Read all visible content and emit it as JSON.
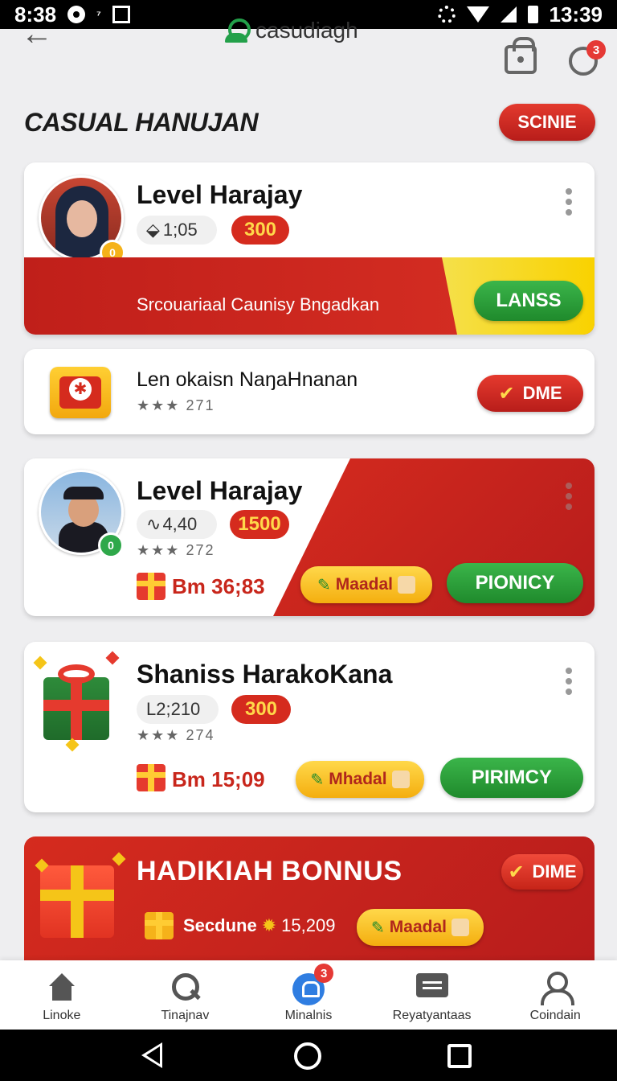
{
  "status_bar": {
    "time_left": "8:38",
    "time_right": "13:39",
    "small_glyph": "⁷"
  },
  "header": {
    "brand": "casudiagh",
    "notif_count": "3"
  },
  "page": {
    "title": "CASUAL HANUJAN",
    "action": "SCINIE"
  },
  "cards": [
    {
      "title": "Level Harajay",
      "stat": "1;05",
      "points": "300",
      "banner_text": "Srcouariaal Caunisy Bngadkan",
      "button": "LANSS",
      "avatar_badge": "0"
    },
    {
      "title": "Len okaisn NaŋaHnanan",
      "rating": "271",
      "button": "DME"
    },
    {
      "title": "Level Harajay",
      "stat": "4,40",
      "points": "1500",
      "rating": "272",
      "reward": "Bm 36;83",
      "gold_button": "Maadal",
      "button": "PIONICY",
      "avatar_badge": "0"
    },
    {
      "title": "Shaniss HarakoKana",
      "stat": "L2;210",
      "points": "300",
      "rating": "274",
      "reward": "Bm 15;09",
      "gold_button": "Mhadal",
      "button": "PIRIMCY"
    }
  ],
  "bonus": {
    "title": "HADIKIAH BONNUS",
    "button": "DIME",
    "label": "Secdune",
    "value": "15,209",
    "gold_button": "Maadal"
  },
  "nav": [
    {
      "label": "Linoke",
      "icon": "home-icon"
    },
    {
      "label": "Tinajnav",
      "icon": "search-icon"
    },
    {
      "label": "Minalnis",
      "icon": "alarm-icon",
      "badge": "3"
    },
    {
      "label": "Reyatyantaas",
      "icon": "message-icon"
    },
    {
      "label": "Coindain",
      "icon": "user-icon"
    }
  ],
  "colors": {
    "accent_red": "#d52b1e",
    "accent_green": "#23a04a",
    "accent_gold": "#f5c518"
  }
}
